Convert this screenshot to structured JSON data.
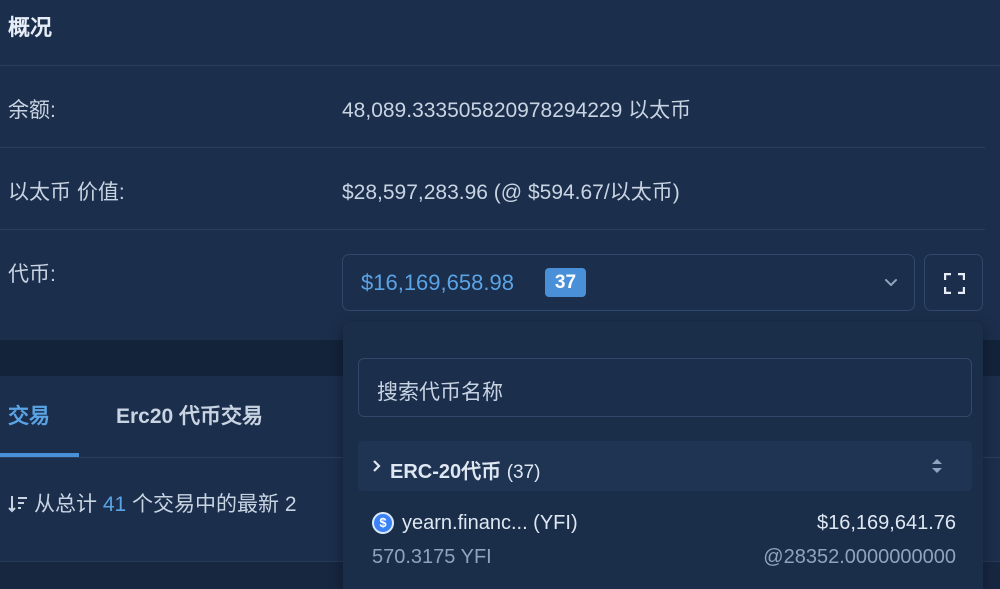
{
  "overview": {
    "title": "概况",
    "balance": {
      "label": "余额:",
      "value": "48,089.333505820978294229 以太币"
    },
    "eth_value": {
      "label": "以太币 价值:",
      "value": "$28,597,283.96 (@ $594.67/以太币)"
    },
    "tokens": {
      "label": "代币:",
      "total": "$16,169,658.98",
      "count": "37"
    }
  },
  "token_dropdown": {
    "search_placeholder": "搜索代币名称",
    "group": {
      "title": "ERC-20代币",
      "count": "(37)"
    },
    "items": [
      {
        "name": "yearn.financ... (YFI)",
        "value": "$16,169,641.76",
        "amount": "570.3175 YFI",
        "rate": "@28352.0000000000"
      }
    ]
  },
  "tabs": [
    {
      "label": "交易",
      "active": true
    },
    {
      "label": "Erc20 代币交易",
      "active": false
    }
  ],
  "summary": {
    "prefix": "从总计",
    "count": "41",
    "suffix": "个交易中的最新 2"
  },
  "colors": {
    "background": "#182a44",
    "card": "#1b2e4b",
    "accent": "#4a90d9",
    "link": "#5aa4e6"
  }
}
